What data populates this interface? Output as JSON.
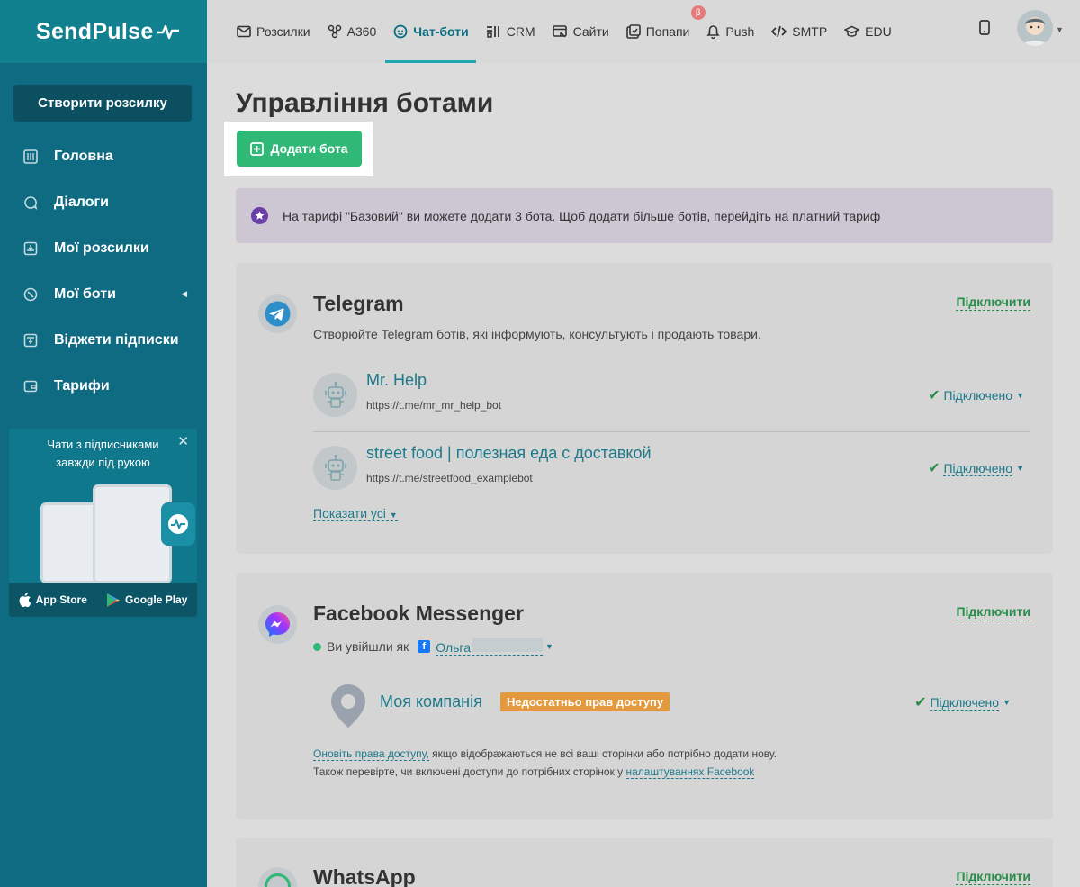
{
  "sidebar": {
    "logo": "SendPulse",
    "create_button": "Створити розсилку",
    "items": [
      {
        "label": "Головна",
        "icon": "dashboard-icon"
      },
      {
        "label": "Діалоги",
        "icon": "chat-bubble-icon"
      },
      {
        "label": "Мої розсилки",
        "icon": "mail-box-icon"
      },
      {
        "label": "Мої боти",
        "icon": "bot-icon"
      },
      {
        "label": "Віджети підписки",
        "icon": "widget-icon"
      },
      {
        "label": "Тарифи",
        "icon": "wallet-icon"
      }
    ],
    "promo": {
      "text": "Чати з підписниками завжди під рукою",
      "app_store": "App Store",
      "google_play": "Google Play"
    }
  },
  "topnav": {
    "items": [
      {
        "label": "Розсилки",
        "icon": "envelope-icon"
      },
      {
        "label": "A360",
        "icon": "automation-icon"
      },
      {
        "label": "Чат-боти",
        "icon": "chatbot-icon"
      },
      {
        "label": "CRM",
        "icon": "crm-icon"
      },
      {
        "label": "Сайти",
        "icon": "site-icon"
      },
      {
        "label": "Попапи",
        "icon": "popup-icon"
      },
      {
        "label": "Push",
        "icon": "bell-icon"
      },
      {
        "label": "SMTP",
        "icon": "code-icon"
      },
      {
        "label": "EDU",
        "icon": "graduation-cap-icon"
      }
    ],
    "active": "Чат-боти",
    "beta_badge": "β"
  },
  "main": {
    "title": "Управління ботами",
    "add_button": "Додати бота",
    "notice": "На тарифі \"Базовий\" ви можете додати 3 бота. Щоб додати більше ботів, перейдіть на платний тариф"
  },
  "telegram": {
    "title": "Telegram",
    "connect": "Підключити",
    "desc": "Створюйте Telegram ботів, які інформують, консультують і продають товари.",
    "bots": [
      {
        "name": "Mr. Help",
        "url": "https://t.me/mr_mr_help_bot",
        "status": "Підключено"
      },
      {
        "name": "street food | полезная еда с доставкой",
        "url": "https://t.me/streetfood_examplebot",
        "status": "Підключено"
      }
    ],
    "show_all": "Показати усі"
  },
  "facebook": {
    "title": "Facebook Messenger",
    "connect": "Підключити",
    "logged_as": "Ви увійшли як",
    "user": "Ольга",
    "page_name": "Моя компанія",
    "no_access": "Недостатньо прав доступу",
    "status": "Підключено",
    "note_link1": "Оновіть права доступу,",
    "note_text1": " якщо відображаються не всі ваші сторінки або потрібно додати нову.",
    "note_text2": "Також перевірте, чи включені доступи до потрібних сторінок у ",
    "note_link2": "налаштуваннях Facebook"
  },
  "whatsapp": {
    "title": "WhatsApp",
    "connect": "Підключити"
  }
}
